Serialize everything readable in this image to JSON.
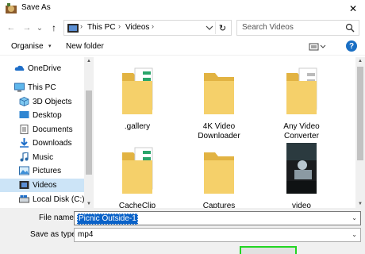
{
  "window": {
    "title": "Save As",
    "close_glyph": "✕"
  },
  "nav": {
    "back_glyph": "←",
    "forward_glyph": "→",
    "recent_glyph": "⌄",
    "up_glyph": "↑",
    "breadcrumbs": [
      "This PC",
      "Videos"
    ],
    "separator": "›",
    "refresh_glyph": "↻",
    "search_placeholder": "Search Videos"
  },
  "commands": {
    "organise": "Organise",
    "organise_arrow": "▾",
    "new_folder": "New folder",
    "help": "?"
  },
  "sidebar": {
    "items": [
      {
        "label": "OneDrive",
        "icon": "cloud-icon"
      },
      {
        "label": "This PC",
        "icon": "computer-icon"
      },
      {
        "label": "3D Objects",
        "icon": "cube-icon"
      },
      {
        "label": "Desktop",
        "icon": "desktop-icon"
      },
      {
        "label": "Documents",
        "icon": "documents-icon"
      },
      {
        "label": "Downloads",
        "icon": "download-icon"
      },
      {
        "label": "Music",
        "icon": "music-icon"
      },
      {
        "label": "Pictures",
        "icon": "pictures-icon"
      },
      {
        "label": "Videos",
        "icon": "videos-icon",
        "selected": true
      },
      {
        "label": "Local Disk (C:)",
        "icon": "disk-icon"
      }
    ]
  },
  "files": [
    {
      "label": ".gallery",
      "kind": "folder-with-docs"
    },
    {
      "label": "4K Video Downloader",
      "kind": "folder"
    },
    {
      "label": "Any Video Converter",
      "kind": "folder-with-docs"
    },
    {
      "label": "CacheClip",
      "kind": "folder-with-docs"
    },
    {
      "label": "Captures",
      "kind": "folder"
    },
    {
      "label": "video",
      "kind": "video-thumbnail"
    }
  ],
  "form": {
    "file_name_label": "File name:",
    "file_name_value": "Picnic Outside-1",
    "save_type_label": "Save as type:",
    "save_type_value": "mp4",
    "dropdown_glyph": "⌄"
  },
  "colors": {
    "accent": "#0a62c8",
    "selected_row": "#cce4f7",
    "folder": "#f0c75a",
    "save_highlight": "#22d622"
  }
}
